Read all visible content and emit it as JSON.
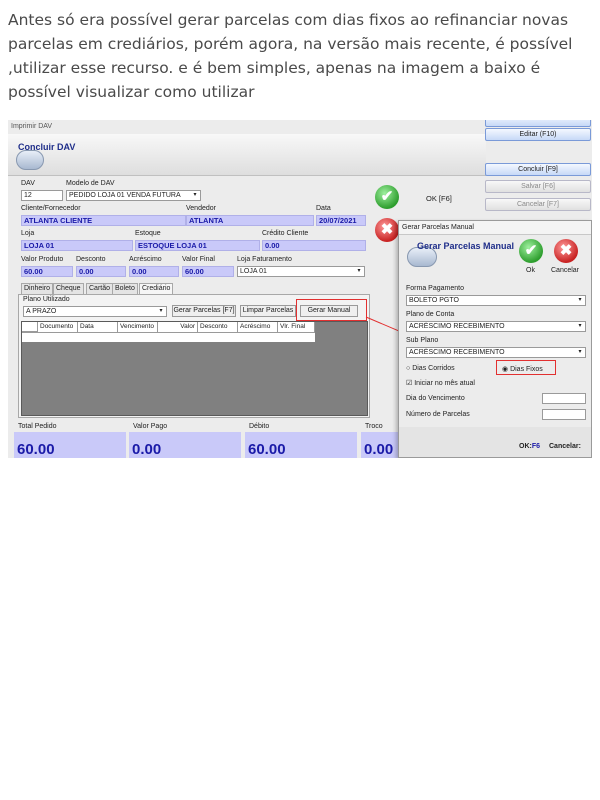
{
  "intro": {
    "text": "Antes só era possível gerar parcelas com dias fixos ao refinanciar novas parcelas em crediários, porém agora, na versão mais recente, é possível ,utilizar esse recurso. e é bem simples, apenas na imagem a baixo é possível visualizar como utilizar"
  },
  "window": {
    "title": "Imprimir DAV",
    "heading": "Concluir DAV",
    "dav_label": "DAV",
    "dav_value": "12",
    "modelo_label": "Modelo de DAV",
    "modelo_value": "PEDIDO LOJA 01 VENDA FUTURA",
    "cliente_label": "Cliente/Fornecedor",
    "cliente_value": "ATLANTA CLIENTE",
    "vendedor_label": "Vendedor",
    "vendedor_value": "ATLANTA",
    "data_label": "Data",
    "data_value": "20/07/2021",
    "loja_label": "Loja",
    "loja_value": "LOJA 01",
    "estoque_label": "Estoque",
    "estoque_value": "ESTOQUE LOJA 01",
    "credito_label": "Crédito Cliente",
    "credito_value": "0.00",
    "valor_produto_label": "Valor Produto",
    "valor_produto_value": "60.00",
    "desconto_label": "Desconto",
    "desconto_value": "0.00",
    "acrescimo_label": "Acréscimo",
    "acrescimo_value": "0.00",
    "valor_final_label": "Valor Final",
    "valor_final_value": "60.00",
    "loja_faturamento_label": "Loja Faturamento",
    "loja_faturamento_value": "LOJA 01",
    "ok_label": "OK [F6]"
  },
  "right_buttons": [
    {
      "label": "Editar (F10)",
      "disabled": false
    },
    {
      "label": "Concluir [F9]",
      "disabled": false
    },
    {
      "label": "Salvar [F6]",
      "disabled": true
    },
    {
      "label": "Cancelar [F7]",
      "disabled": true
    }
  ],
  "tabs": [
    "Dinheiro",
    "Cheque",
    "Cartão",
    "Boleto",
    "Crediário"
  ],
  "crediario": {
    "plano_label": "Plano Utilizado",
    "plano_value": "A PRAZO",
    "gerar_parcelas": "Gerar Parcelas [F7]",
    "limpar_parcelas": "Limpar Parcelas",
    "gerar_manual": "Gerar Manual",
    "columns": [
      "Documento",
      "Data",
      "Vencimento",
      "Valor",
      "Desconto",
      "Acréscimo",
      "Vlr. Final"
    ]
  },
  "totals": [
    {
      "label": "Total Pedido",
      "value": "60.00"
    },
    {
      "label": "Valor Pago",
      "value": "0.00"
    },
    {
      "label": "Débito",
      "value": "60.00"
    },
    {
      "label": "Troco",
      "value": "0.00"
    }
  ],
  "dialog": {
    "title": "Gerar Parcelas Manual",
    "heading": "Gerar Parcelas Manual",
    "ok_label": "Ok",
    "cancel_label": "Cancelar",
    "forma_label": "Forma Pagamento",
    "forma_value": "BOLETO PGTO",
    "plano_conta_label": "Plano de Conta",
    "plano_conta_value": "ACRÉSCIMO RECEBIMENTO",
    "sub_plano_label": "Sub Plano",
    "sub_plano_value": "ACRÉSCIMO RECEBIMENTO",
    "dias_corridos": "Dias Corridos",
    "dias_fixos": "Dias Fixos",
    "iniciar_label": "Iniciar no mês atual",
    "dia_vencimento_label": "Dia do Vencimento",
    "numero_parcelas_label": "Número de Parcelas",
    "footer_ok_prefix": "OK:",
    "footer_ok_key": "F6",
    "footer_cancel": "Cancelar:"
  },
  "colors": {
    "field_bg": "#c9c9f9",
    "field_text": "#1a1aa8",
    "highlight": "#e23030",
    "window_bg": "#ececec"
  }
}
